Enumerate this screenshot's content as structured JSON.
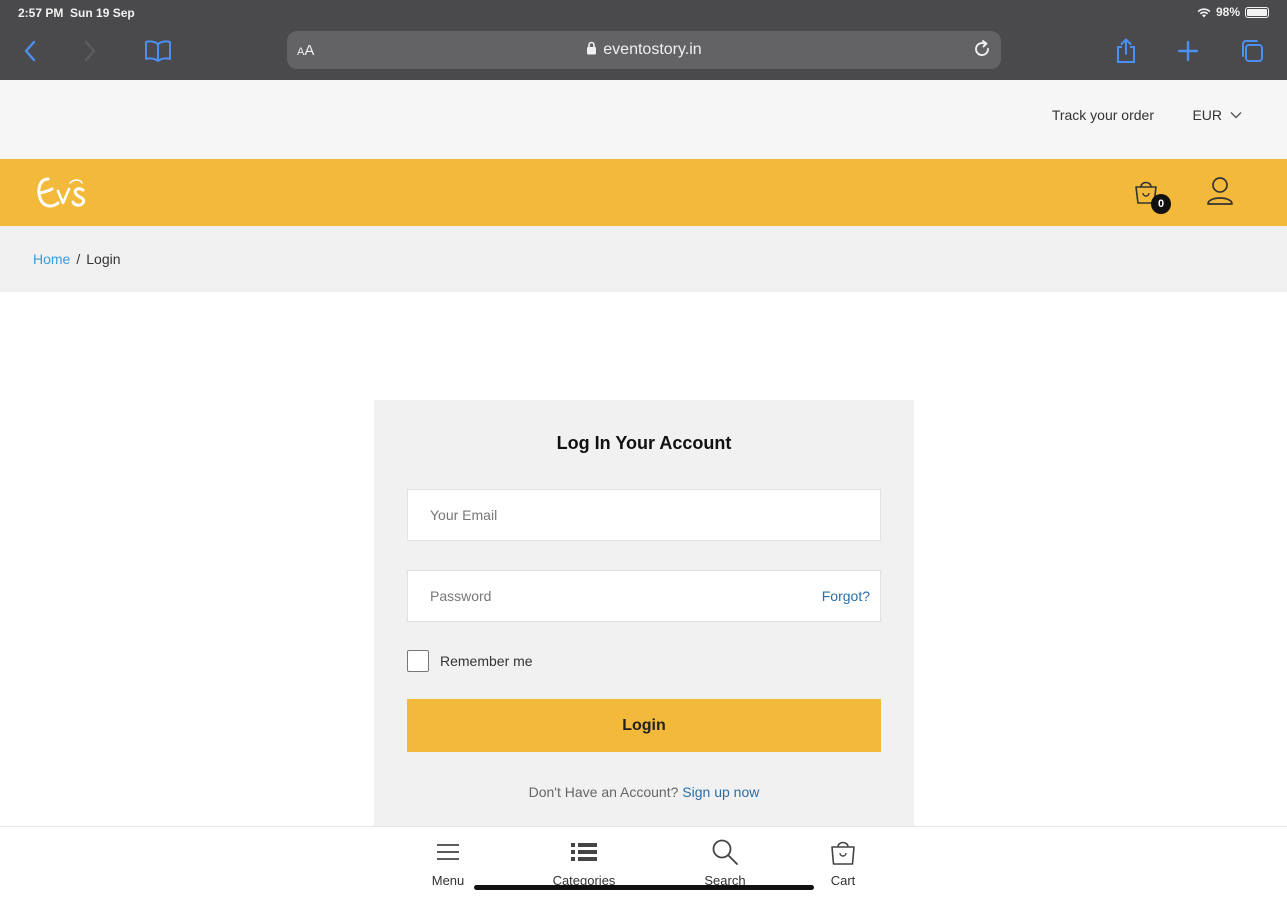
{
  "status_bar": {
    "time": "2:57 PM",
    "date": "Sun 19 Sep",
    "battery": "98%"
  },
  "browser": {
    "aa_small": "A",
    "aa_large": "A",
    "url": "eventostory.in"
  },
  "topbar": {
    "track_order": "Track your order",
    "currency": "EUR"
  },
  "header": {
    "logo_alt": "Eves",
    "cart_count": "0"
  },
  "breadcrumb": {
    "home": "Home",
    "separator": "/",
    "current": "Login"
  },
  "login": {
    "title": "Log In Your Account",
    "email_placeholder": "Your Email",
    "password_placeholder": "Password",
    "forgot": "Forgot?",
    "remember_label": "Remember me",
    "login_button": "Login",
    "no_account_text": "Don't Have an Account?",
    "signup_link": "Sign up now"
  },
  "bottom_nav": [
    {
      "label": "Menu",
      "icon": "menu-icon"
    },
    {
      "label": "Categories",
      "icon": "list-icon"
    },
    {
      "label": "Search",
      "icon": "search-icon"
    },
    {
      "label": "Cart",
      "icon": "cart-icon"
    }
  ],
  "colors": {
    "accent": "#f2b93b",
    "link": "#2a6ea8",
    "breadcrumb_link": "#3a9bd9"
  }
}
